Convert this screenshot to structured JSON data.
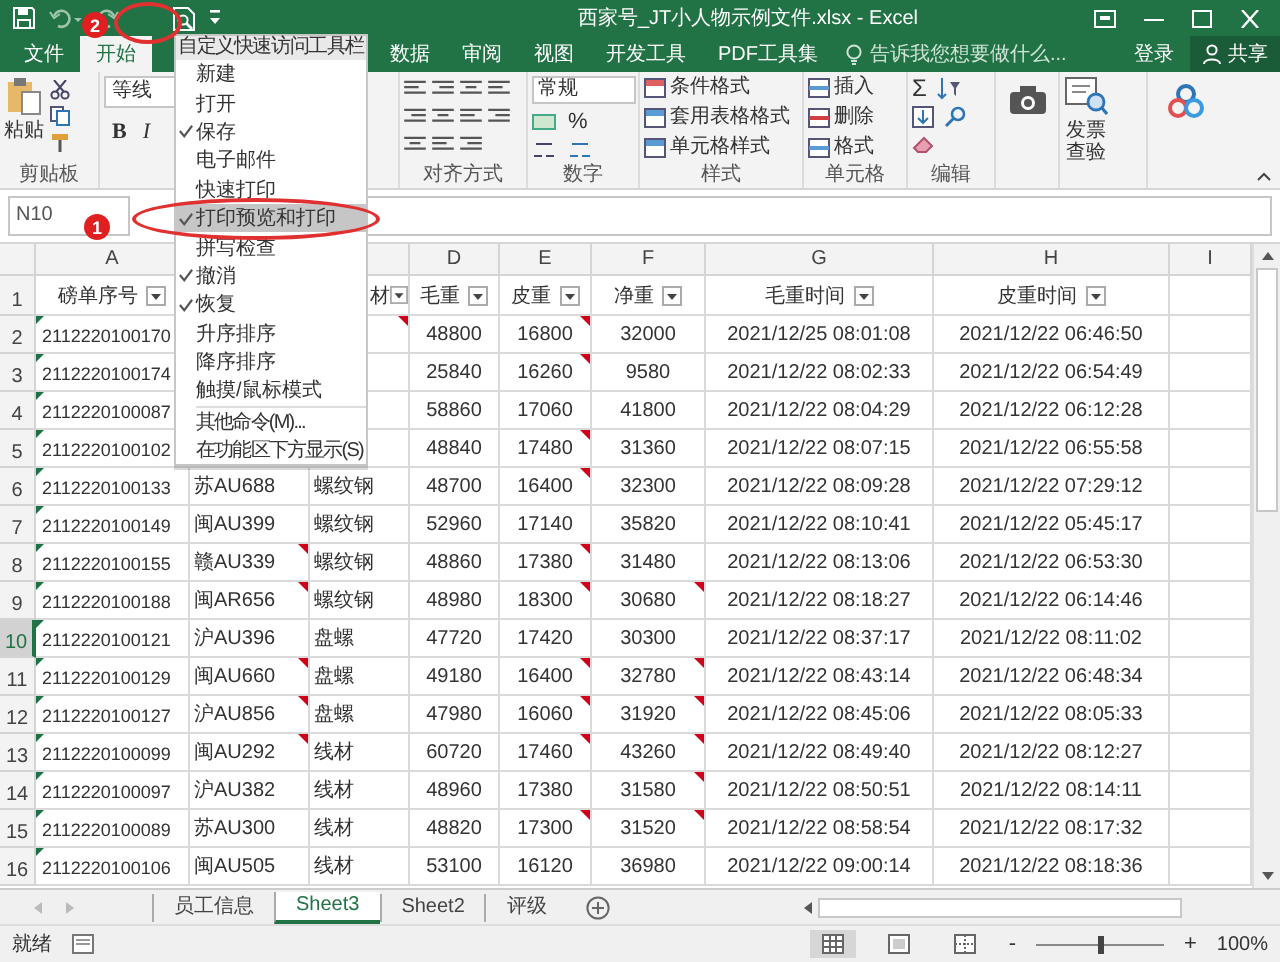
{
  "window": {
    "title": "西家号_JT小人物示例文件.xlsx - Excel"
  },
  "tabs": [
    {
      "label": "文件",
      "selected": false
    },
    {
      "label": "开始",
      "selected": true
    },
    {
      "label": "数据",
      "selected": false
    },
    {
      "label": "审阅",
      "selected": false
    },
    {
      "label": "视图",
      "selected": false
    },
    {
      "label": "开发工具",
      "selected": false
    },
    {
      "label": "PDF工具集",
      "selected": false
    }
  ],
  "tell_me": {
    "placeholder": "告诉我您想要做什么..."
  },
  "account": {
    "sign_in": "登录",
    "share": "共享"
  },
  "ribbon": [
    {
      "kind": "clipboard",
      "label": "剪贴板",
      "paste": "粘贴"
    },
    {
      "kind": "font",
      "font": "等线",
      "bold": "B",
      "italic": "I"
    },
    {
      "kind": "alignment",
      "label": "对齐方式"
    },
    {
      "kind": "number",
      "label": "数字",
      "format": "常规",
      "percent": "%"
    },
    {
      "kind": "styles",
      "label": "样式",
      "buttons": [
        "条件格式",
        "套用表格格式",
        "单元格样式"
      ]
    },
    {
      "kind": "cells",
      "label": "单元格",
      "buttons": [
        "插入",
        "删除",
        "格式"
      ]
    },
    {
      "kind": "editing",
      "label": "编辑",
      "sum": "Σ"
    },
    {
      "kind": "camera"
    },
    {
      "kind": "invoice",
      "button": "发票查验"
    },
    {
      "kind": "cloud"
    }
  ],
  "name_box": "N10",
  "menu": {
    "title": "自定义快速访问工具栏",
    "items": [
      {
        "label": "新建",
        "checked": false,
        "selected": false
      },
      {
        "label": "打开",
        "checked": false,
        "selected": false
      },
      {
        "label": "保存",
        "checked": true,
        "selected": false
      },
      {
        "label": "电子邮件",
        "checked": false,
        "selected": false
      },
      {
        "label": "快速打印",
        "checked": false,
        "selected": false
      },
      {
        "label": "打印预览和打印",
        "checked": true,
        "selected": true
      },
      {
        "label": "拼写检查",
        "checked": false,
        "selected": false
      },
      {
        "label": "撤消",
        "checked": true,
        "selected": false
      },
      {
        "label": "恢复",
        "checked": true,
        "selected": false
      },
      {
        "label": "升序排序",
        "checked": false,
        "selected": false
      },
      {
        "label": "降序排序",
        "checked": false,
        "selected": false
      },
      {
        "label": "触摸/鼠标模式",
        "checked": false,
        "selected": false
      }
    ],
    "commands": [
      "其他命令(M)...",
      "在功能区下方显示(S)"
    ]
  },
  "annotations": [
    {
      "number": "2"
    },
    {
      "number": "1"
    }
  ],
  "columns": [
    {
      "letter": "A"
    },
    {
      "letter": "D"
    },
    {
      "letter": "E"
    },
    {
      "letter": "F"
    },
    {
      "letter": "G"
    },
    {
      "letter": "H"
    },
    {
      "letter": "I"
    }
  ],
  "header": {
    "number": "1",
    "id": "磅单序号",
    "material": "材",
    "gross": "毛重",
    "tare": "皮重",
    "net": "净重",
    "gross_time": "毛重时间",
    "tare_time": "皮重时间"
  },
  "rows": [
    {
      "number": "2",
      "selected": false,
      "cells": [
        {
          "text": "2112220100170",
          "comment": false
        },
        null,
        {
          "comment": true
        },
        {
          "text": "48800",
          "comment": false
        },
        {
          "text": "16800",
          "comment": true
        },
        {
          "text": "32000",
          "comment": false
        },
        {
          "text": "2021/12/25 08:01:08",
          "comment": false
        },
        {
          "text": "2021/12/22 06:46:50",
          "comment": false
        }
      ]
    },
    {
      "number": "3",
      "selected": false,
      "cells": [
        {
          "text": "2112220100174",
          "comment": false
        },
        null,
        null,
        {
          "text": "25840",
          "comment": false
        },
        {
          "text": "16260",
          "comment": true
        },
        {
          "text": "9580",
          "comment": false
        },
        {
          "text": "2021/12/22 08:02:33",
          "comment": false
        },
        {
          "text": "2021/12/22 06:54:49",
          "comment": false
        }
      ]
    },
    {
      "number": "4",
      "selected": false,
      "cells": [
        {
          "text": "2112220100087",
          "comment": false
        },
        null,
        null,
        {
          "text": "58860",
          "comment": false
        },
        {
          "text": "17060",
          "comment": false
        },
        {
          "text": "41800",
          "comment": false
        },
        {
          "text": "2021/12/22 08:04:29",
          "comment": false
        },
        {
          "text": "2021/12/22 06:12:28",
          "comment": false
        }
      ]
    },
    {
      "number": "5",
      "selected": false,
      "cells": [
        {
          "text": "2112220100102",
          "comment": false
        },
        null,
        null,
        {
          "text": "48840",
          "comment": false
        },
        {
          "text": "17480",
          "comment": true
        },
        {
          "text": "31360",
          "comment": false
        },
        {
          "text": "2021/12/22 08:07:15",
          "comment": false
        },
        {
          "text": "2021/12/22 06:55:58",
          "comment": false
        }
      ]
    },
    {
      "number": "6",
      "selected": false,
      "cells": [
        {
          "text": "2112220100133",
          "comment": false
        },
        {
          "text": "苏AU688",
          "comment": false
        },
        {
          "text": "螺纹钢",
          "comment": false
        },
        {
          "text": "48700",
          "comment": false
        },
        {
          "text": "16400",
          "comment": true
        },
        {
          "text": "32300",
          "comment": false
        },
        {
          "text": "2021/12/22 08:09:28",
          "comment": false
        },
        {
          "text": "2021/12/22 07:29:12",
          "comment": false
        }
      ]
    },
    {
      "number": "7",
      "selected": false,
      "cells": [
        {
          "text": "2112220100149",
          "comment": false
        },
        {
          "text": "闽AU399",
          "comment": false
        },
        {
          "text": "螺纹钢",
          "comment": false
        },
        {
          "text": "52960",
          "comment": false
        },
        {
          "text": "17140",
          "comment": false
        },
        {
          "text": "35820",
          "comment": false
        },
        {
          "text": "2021/12/22 08:10:41",
          "comment": false
        },
        {
          "text": "2021/12/22 05:45:17",
          "comment": false
        }
      ]
    },
    {
      "number": "8",
      "selected": false,
      "cells": [
        {
          "text": "2112220100155",
          "comment": false
        },
        {
          "text": "赣AU339",
          "comment": true
        },
        {
          "text": "螺纹钢",
          "comment": false
        },
        {
          "text": "48860",
          "comment": false
        },
        {
          "text": "17380",
          "comment": true
        },
        {
          "text": "31480",
          "comment": false
        },
        {
          "text": "2021/12/22 08:13:06",
          "comment": false
        },
        {
          "text": "2021/12/22 06:53:30",
          "comment": false
        }
      ]
    },
    {
      "number": "9",
      "selected": false,
      "cells": [
        {
          "text": "2112220100188",
          "comment": false
        },
        {
          "text": "闽AR656",
          "comment": true
        },
        {
          "text": "螺纹钢",
          "comment": false
        },
        {
          "text": "48980",
          "comment": false
        },
        {
          "text": "18300",
          "comment": true
        },
        {
          "text": "30680",
          "comment": true
        },
        {
          "text": "2021/12/22 08:18:27",
          "comment": false
        },
        {
          "text": "2021/12/22 06:14:46",
          "comment": false
        }
      ]
    },
    {
      "number": "10",
      "selected": true,
      "cells": [
        {
          "text": "2112220100121",
          "comment": false
        },
        {
          "text": "沪AU396",
          "comment": false
        },
        {
          "text": "盘螺",
          "comment": false
        },
        {
          "text": "47720",
          "comment": false
        },
        {
          "text": "17420",
          "comment": false
        },
        {
          "text": "30300",
          "comment": false
        },
        {
          "text": "2021/12/22 08:37:17",
          "comment": false
        },
        {
          "text": "2021/12/22 08:11:02",
          "comment": false
        }
      ]
    },
    {
      "number": "11",
      "selected": false,
      "cells": [
        {
          "text": "2112220100129",
          "comment": false
        },
        {
          "text": "闽AU660",
          "comment": true
        },
        {
          "text": "盘螺",
          "comment": false
        },
        {
          "text": "49180",
          "comment": false
        },
        {
          "text": "16400",
          "comment": true
        },
        {
          "text": "32780",
          "comment": true
        },
        {
          "text": "2021/12/22 08:43:14",
          "comment": false
        },
        {
          "text": "2021/12/22 06:48:34",
          "comment": false
        }
      ]
    },
    {
      "number": "12",
      "selected": false,
      "cells": [
        {
          "text": "2112220100127",
          "comment": false
        },
        {
          "text": "沪AU856",
          "comment": true
        },
        {
          "text": "盘螺",
          "comment": false
        },
        {
          "text": "47980",
          "comment": false
        },
        {
          "text": "16060",
          "comment": true
        },
        {
          "text": "31920",
          "comment": true
        },
        {
          "text": "2021/12/22 08:45:06",
          "comment": false
        },
        {
          "text": "2021/12/22 08:05:33",
          "comment": false
        }
      ]
    },
    {
      "number": "13",
      "selected": false,
      "cells": [
        {
          "text": "2112220100099",
          "comment": false
        },
        {
          "text": "闽AU292",
          "comment": true
        },
        {
          "text": "线材",
          "comment": false
        },
        {
          "text": "60720",
          "comment": false
        },
        {
          "text": "17460",
          "comment": true
        },
        {
          "text": "43260",
          "comment": true
        },
        {
          "text": "2021/12/22 08:49:40",
          "comment": false
        },
        {
          "text": "2021/12/22 08:12:27",
          "comment": false
        }
      ]
    },
    {
      "number": "14",
      "selected": false,
      "cells": [
        {
          "text": "2112220100097",
          "comment": false
        },
        {
          "text": "沪AU382",
          "comment": false
        },
        {
          "text": "线材",
          "comment": false
        },
        {
          "text": "48960",
          "comment": false
        },
        {
          "text": "17380",
          "comment": false
        },
        {
          "text": "31580",
          "comment": true
        },
        {
          "text": "2021/12/22 08:50:51",
          "comment": false
        },
        {
          "text": "2021/12/22 08:14:11",
          "comment": false
        }
      ]
    },
    {
      "number": "15",
      "selected": false,
      "cells": [
        {
          "text": "2112220100089",
          "comment": false
        },
        {
          "text": "苏AU300",
          "comment": false
        },
        {
          "text": "线材",
          "comment": false
        },
        {
          "text": "48820",
          "comment": false
        },
        {
          "text": "17300",
          "comment": true
        },
        {
          "text": "31520",
          "comment": true
        },
        {
          "text": "2021/12/22 08:58:54",
          "comment": false
        },
        {
          "text": "2021/12/22 08:17:32",
          "comment": false
        }
      ]
    },
    {
      "number": "16",
      "selected": false,
      "cells": [
        {
          "text": "2112220100106",
          "comment": false
        },
        {
          "text": "闽AU505",
          "comment": false
        },
        {
          "text": "线材",
          "comment": false
        },
        {
          "text": "53100",
          "comment": false
        },
        {
          "text": "16120",
          "comment": false
        },
        {
          "text": "36980",
          "comment": false
        },
        {
          "text": "2021/12/22 09:00:14",
          "comment": false
        },
        {
          "text": "2021/12/22 08:18:36",
          "comment": false
        }
      ]
    }
  ],
  "sheets": [
    {
      "label": "员工信息",
      "selected": false
    },
    {
      "label": "Sheet3",
      "selected": true
    },
    {
      "label": "Sheet2",
      "selected": false
    },
    {
      "label": "评级",
      "selected": false
    }
  ],
  "status": {
    "text": "就绪",
    "zoom": "100%",
    "minus": "-",
    "plus": "+"
  },
  "views": [
    {
      "kind": "normal",
      "selected": true
    },
    {
      "kind": "page_layout",
      "selected": false
    },
    {
      "kind": "page_break",
      "selected": false
    }
  ],
  "zoom_slider": {
    "level": 0.5
  }
}
